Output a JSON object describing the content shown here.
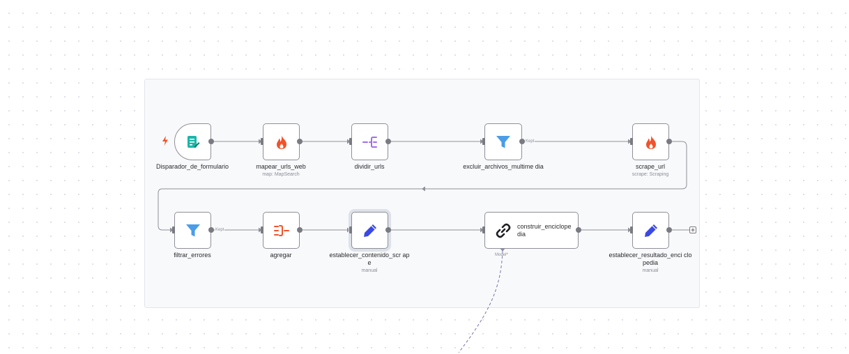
{
  "canvas": {
    "nodes": {
      "disparador": {
        "label": "Disparador_de_formulario",
        "icon": "form-icon"
      },
      "mapear": {
        "label": "mapear_urls_web",
        "subtitle": "map: MapSearch",
        "icon": "flame-icon"
      },
      "dividir": {
        "label": "dividir_urls",
        "icon": "split-icon"
      },
      "excluir": {
        "label": "excluir_archivos_multime dia",
        "icon": "filter-icon"
      },
      "scrape": {
        "label": "scrape_url",
        "subtitle": "scrape: Scraping",
        "icon": "flame-icon"
      },
      "filtrar": {
        "label": "filtrar_errores",
        "icon": "filter-icon"
      },
      "agregar": {
        "label": "agregar",
        "icon": "aggregate-icon"
      },
      "establecer_contenido": {
        "label": "establecer_contenido_scr ape",
        "subtitle": "manual",
        "icon": "pencil-icon"
      },
      "construir": {
        "label": "construir_enciclope dia",
        "icon": "link-icon"
      },
      "establecer_resultado": {
        "label": "establecer_resultado_enci clopedia",
        "subtitle": "manual",
        "icon": "pencil-icon"
      }
    },
    "connections": {
      "kept_label": "Kept",
      "model_label": "Model",
      "model_required_mark": "*"
    }
  },
  "colors": {
    "flame": "#f0532b",
    "filter": "#4a9de8",
    "split": "#a26ee6",
    "pencil": "#3a49e6",
    "form": "#1cb5a8",
    "aggregate": "#f0532b",
    "model_wire": "#7b75a8"
  }
}
